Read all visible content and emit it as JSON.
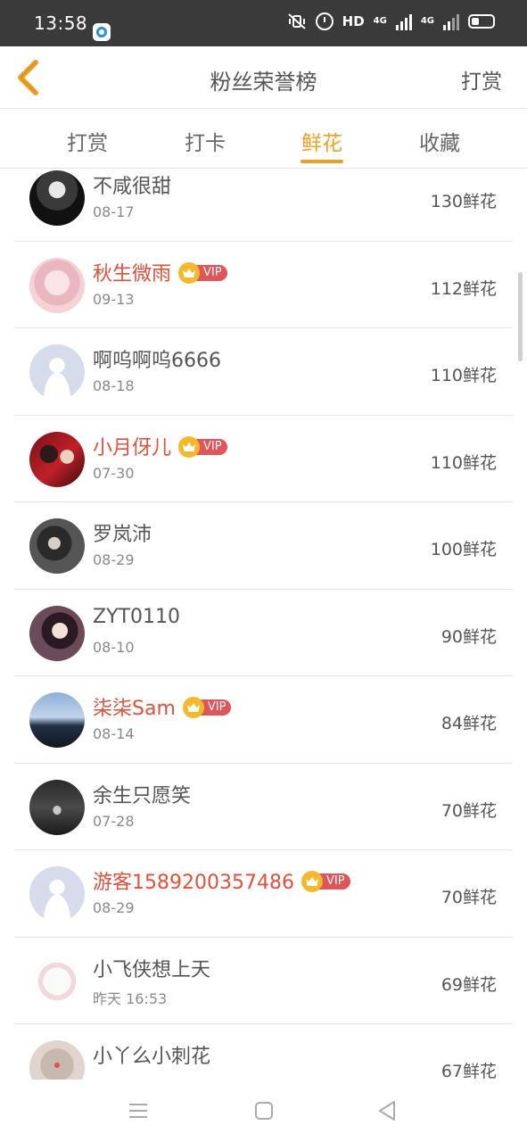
{
  "status": {
    "time": "13:58",
    "hd": "HD",
    "net1": "4G",
    "net2": "4G"
  },
  "header": {
    "title": "粉丝荣誉榜",
    "action": "打赏"
  },
  "tabs": [
    "打赏",
    "打卡",
    "鲜花",
    "收藏"
  ],
  "active_tab": "鲜花",
  "colors": {
    "accent": "#f0a020",
    "vip_name": "#e0503a",
    "vip_badge": "#e0555a",
    "crown": "#f5b82a"
  },
  "vip_label": "VIP",
  "rows": [
    {
      "name": "不咸很甜",
      "date": "08-17",
      "amount": "130鲜花",
      "vip": false,
      "avatar": "dark-portrait"
    },
    {
      "name": "秋生微雨",
      "date": "09-13",
      "amount": "112鲜花",
      "vip": true,
      "avatar": "anime-pink"
    },
    {
      "name": "啊呜啊呜6666",
      "date": "08-18",
      "amount": "110鲜花",
      "vip": false,
      "avatar": "default-user"
    },
    {
      "name": "小月伢儿",
      "date": "07-30",
      "amount": "110鲜花",
      "vip": true,
      "avatar": "couple-fan"
    },
    {
      "name": "罗岚沛",
      "date": "08-29",
      "amount": "100鲜花",
      "vip": false,
      "avatar": "dark-girl"
    },
    {
      "name": "ZYT0110",
      "date": "08-10",
      "amount": "90鲜花",
      "vip": false,
      "avatar": "portrait-woman"
    },
    {
      "name": "柒柒Sam",
      "date": "08-14",
      "amount": "84鲜花",
      "vip": true,
      "avatar": "sky-silhouette"
    },
    {
      "name": "余生只愿笑",
      "date": "07-28",
      "amount": "70鲜花",
      "vip": false,
      "avatar": "forest-figure"
    },
    {
      "name": "游客1589200357486",
      "date": "08-29",
      "amount": "70鲜花",
      "vip": true,
      "avatar": "default-user"
    },
    {
      "name": "小飞侠想上天",
      "date": "昨天 16:53",
      "amount": "69鲜花",
      "vip": false,
      "avatar": "anime-white"
    },
    {
      "name": "小丫么小刺花",
      "date": "",
      "amount": "67鲜花",
      "vip": false,
      "avatar": "hands-heart"
    }
  ]
}
